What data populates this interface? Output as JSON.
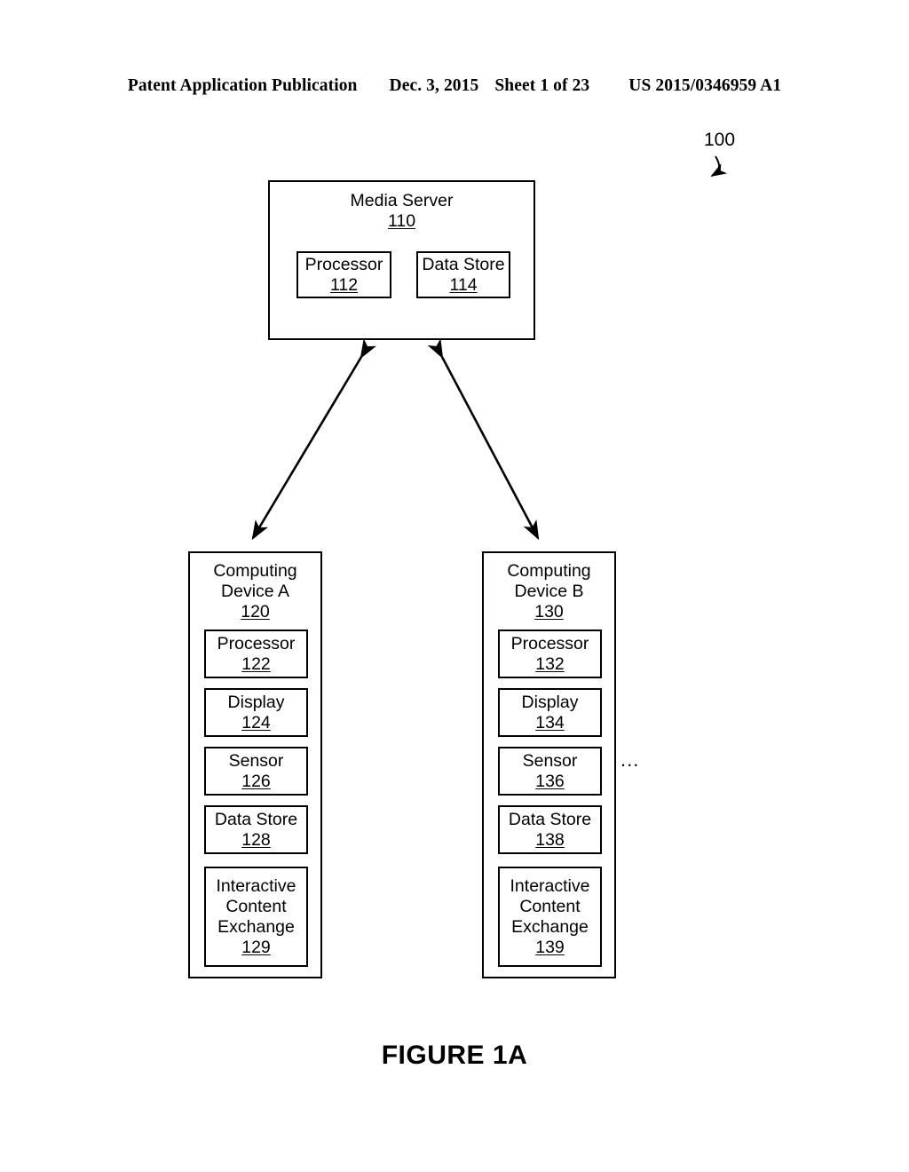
{
  "header": {
    "publication": "Patent Application Publication",
    "date": "Dec. 3, 2015",
    "sheet": "Sheet 1 of 23",
    "patent_number": "US 2015/0346959 A1"
  },
  "figure": {
    "caption": "FIGURE 1A",
    "system_ref": "100",
    "ellipsis": "...",
    "line_color": "#000000"
  },
  "media_server": {
    "title": "Media Server",
    "ref": "110",
    "components": [
      {
        "label": "Processor",
        "ref": "112"
      },
      {
        "label": "Data Store",
        "ref": "114"
      }
    ]
  },
  "devices": [
    {
      "title_line1": "Computing",
      "title_line2": "Device A",
      "ref": "120",
      "components": [
        {
          "lines": [
            "Processor"
          ],
          "ref": "122"
        },
        {
          "lines": [
            "Display"
          ],
          "ref": "124"
        },
        {
          "lines": [
            "Sensor"
          ],
          "ref": "126"
        },
        {
          "lines": [
            "Data Store"
          ],
          "ref": "128"
        },
        {
          "lines": [
            "Interactive",
            "Content",
            "Exchange"
          ],
          "ref": "129"
        }
      ]
    },
    {
      "title_line1": "Computing",
      "title_line2": "Device B",
      "ref": "130",
      "components": [
        {
          "lines": [
            "Processor"
          ],
          "ref": "132"
        },
        {
          "lines": [
            "Display"
          ],
          "ref": "134"
        },
        {
          "lines": [
            "Sensor"
          ],
          "ref": "136"
        },
        {
          "lines": [
            "Data Store"
          ],
          "ref": "138"
        },
        {
          "lines": [
            "Interactive",
            "Content",
            "Exchange"
          ],
          "ref": "139"
        }
      ]
    }
  ]
}
